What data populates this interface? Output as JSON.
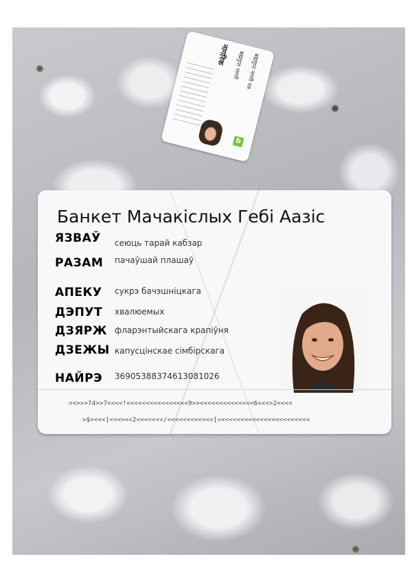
{
  "small_card": {
    "title": "नागरिक",
    "line_a": "ब्रह्मगुप्त नागरी",
    "line_b": "ब्रह्मगुप्त नागरी पत्र",
    "logo": "b"
  },
  "card": {
    "title": "Банкет Мачакіслых Гебі Аазіс",
    "fields": [
      {
        "label": "ЯЗВАЎ",
        "value": "сеюць тарай кабзар"
      },
      {
        "label": "РАЗАМ",
        "value": "пачаўшай плашаў"
      },
      {
        "label": "АПЕКУ",
        "value": "сукрэ бачэшніцкага"
      },
      {
        "label": "ДЭПУТ",
        "value": "хвалюемых"
      },
      {
        "label": "ДЗЯРЖ",
        "value": "фларэнтыйскага крапіўня"
      },
      {
        "label": "ДЗЕЖЫ",
        "value": "капусцінскае сімбірскага"
      },
      {
        "label": "НАЙРЭ",
        "value": "36905388374613081026"
      }
    ],
    "mrz_1": "<<>>>74>>7<<<<!<<<<<<<<<<<<<<<<9>><<<<<<<<<<<<<<6<<<>2<<<<",
    "mrz_2": ">$><<<]<<<><<2<<<<<<</<<<<<<<<<<<<[<<<<<<<<<<<<<<<<<<<<<<<<"
  }
}
